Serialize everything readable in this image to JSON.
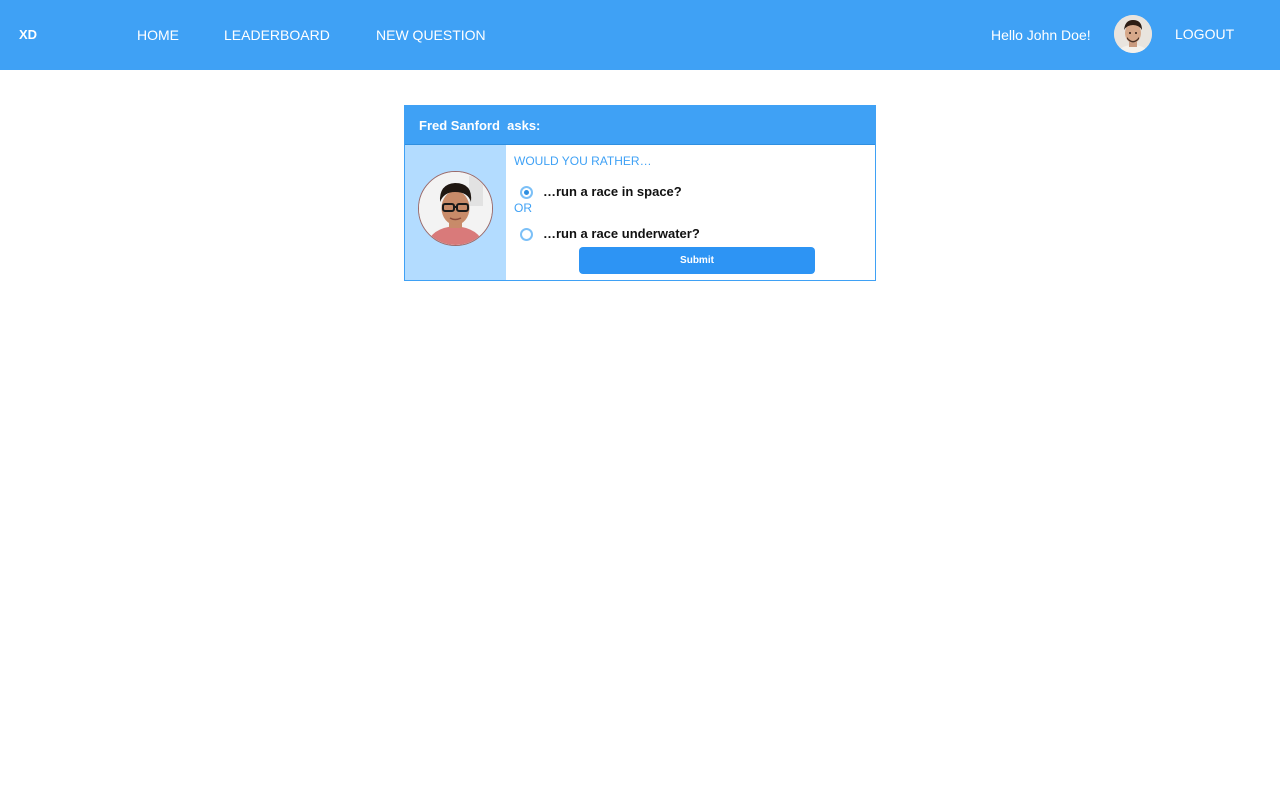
{
  "navbar": {
    "brand": "XD",
    "links": [
      {
        "label": "HOME"
      },
      {
        "label": "LEADERBOARD"
      },
      {
        "label": "NEW QUESTION"
      }
    ],
    "greeting": "Hello John Doe!",
    "logout_label": "LOGOUT",
    "background_color": "#3fa1f5"
  },
  "question": {
    "author": "Fred Sanford",
    "asks_suffix": "asks:",
    "prompt": "WOULD YOU RATHER…",
    "options": [
      {
        "text": "…run a race in space?",
        "selected": true
      },
      {
        "text": "…run a race underwater?",
        "selected": false
      }
    ],
    "separator": "OR",
    "submit_label": "Submit"
  }
}
